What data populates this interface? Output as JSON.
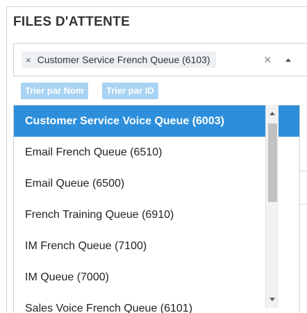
{
  "panel": {
    "title": "FILES D'ATTENTE"
  },
  "select": {
    "selected_tag": {
      "label": "Customer Service French Queue (6103)",
      "remove_icon": "×"
    },
    "clear_icon": "×"
  },
  "sort_buttons": {
    "by_name": "Trier par Nom",
    "by_id": "Trier par ID"
  },
  "options": [
    "Customer Service Voice Queue (6003)",
    "Email French Queue (6510)",
    "Email Queue (6500)",
    "French Training Queue (6910)",
    "IM French Queue (7100)",
    "IM Queue (7000)",
    "Sales Voice French Queue (6101)"
  ],
  "highlighted_index": 0,
  "behind_text": "é",
  "colors": {
    "highlight": "#2d8fdb",
    "sort_button": "#a9d3f3",
    "title": "#333333"
  }
}
